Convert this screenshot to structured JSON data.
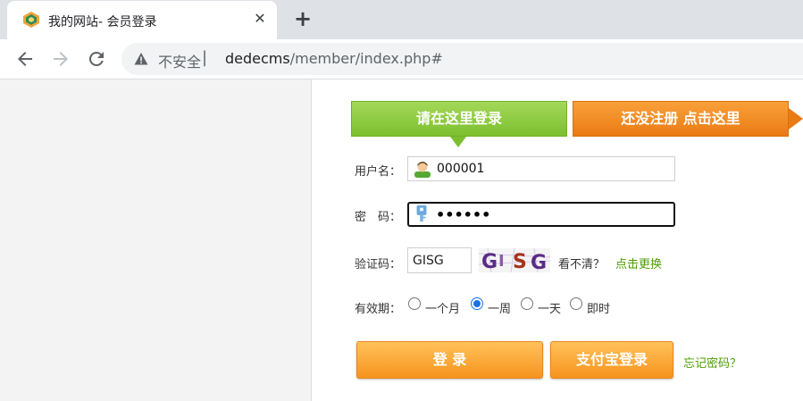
{
  "browser": {
    "tab_title": "我的网站- 会员登录",
    "close_icon": "close-icon",
    "new_tab_icon": "plus-icon",
    "security_label": "不安全",
    "separator": "|",
    "url_host": "dedecms",
    "url_path": "/member/index.php#"
  },
  "tabs": {
    "login": "请在这里登录",
    "register": "还没注册 点击这里"
  },
  "form": {
    "username_label": "用户名：",
    "username_value": "000001",
    "password_label": "密　码：",
    "password_value": "••••••",
    "captcha_label": "验证码：",
    "captcha_value": "GISG",
    "captcha_image_text": "GISG",
    "captcha_hint": "看不清？",
    "captcha_refresh": "点击更换",
    "validity_label": "有效期：",
    "validity_options": [
      {
        "label": "一个月",
        "checked": false
      },
      {
        "label": "一周",
        "checked": true
      },
      {
        "label": "一天",
        "checked": false
      },
      {
        "label": "即时",
        "checked": false
      }
    ],
    "login_button": "登 录",
    "alipay_button": "支付宝登录",
    "forgot_link": "忘记密码？"
  },
  "colors": {
    "login_tab": "#7cbf2e",
    "register_tab": "#ea7b14",
    "button": "#f7931e",
    "link": "#4e9d06"
  }
}
